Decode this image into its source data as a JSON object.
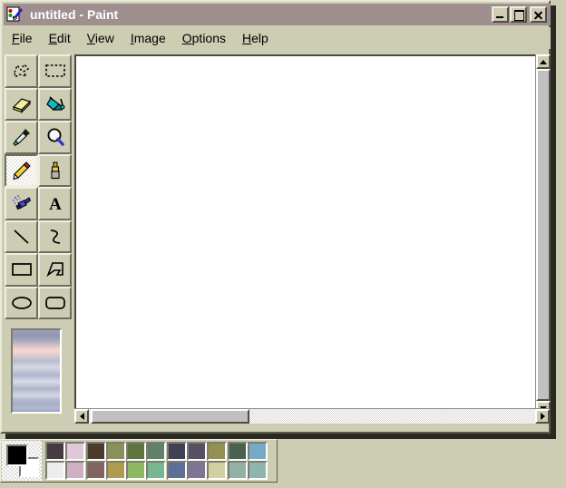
{
  "window": {
    "title": "untitled - Paint",
    "icon": "paint-app-icon",
    "buttons": {
      "minimize": "_",
      "maximize": "□",
      "close": "✕"
    }
  },
  "menubar": {
    "items": [
      {
        "label": "File",
        "accel": "F"
      },
      {
        "label": "Edit",
        "accel": "E"
      },
      {
        "label": "View",
        "accel": "V"
      },
      {
        "label": "Image",
        "accel": "I"
      },
      {
        "label": "Options",
        "accel": "O"
      },
      {
        "label": "Help",
        "accel": "H"
      }
    ]
  },
  "toolbox": {
    "selected": "pencil",
    "tools": [
      {
        "id": "free-form-select",
        "label": "Free-Form Select"
      },
      {
        "id": "rectangle-select",
        "label": "Select"
      },
      {
        "id": "eraser",
        "label": "Eraser/Color Eraser"
      },
      {
        "id": "fill",
        "label": "Fill With Color"
      },
      {
        "id": "color-picker",
        "label": "Pick Color"
      },
      {
        "id": "magnifier",
        "label": "Magnifier"
      },
      {
        "id": "pencil",
        "label": "Pencil"
      },
      {
        "id": "brush",
        "label": "Brush"
      },
      {
        "id": "airbrush",
        "label": "Airbrush"
      },
      {
        "id": "text",
        "label": "Text"
      },
      {
        "id": "line",
        "label": "Line"
      },
      {
        "id": "curve",
        "label": "Curve"
      },
      {
        "id": "rectangle",
        "label": "Rectangle"
      },
      {
        "id": "polygon",
        "label": "Polygon"
      },
      {
        "id": "ellipse",
        "label": "Ellipse"
      },
      {
        "id": "rounded-rectangle",
        "label": "Rounded Rectangle"
      }
    ]
  },
  "tool_options": {
    "preview_label": "tool-options-preview"
  },
  "canvas": {
    "background": "#ffffff"
  },
  "scrollbars": {
    "vertical": {
      "up": "▲",
      "down": "▼"
    },
    "horizontal": {
      "left": "◀",
      "right": "▶"
    }
  },
  "palette": {
    "foreground": "#000000",
    "background": "#ffffff",
    "row1": [
      "#463b41",
      "#e0c8da",
      "#4c3b2c",
      "#8b8f5a",
      "#5e753f",
      "#5d8169",
      "#3f4257",
      "#574f63",
      "#94904f",
      "#4a6050",
      "#76aac4"
    ],
    "row2": [
      "#ececec",
      "#cfafc4",
      "#81645f",
      "#b09a4f",
      "#8cba60",
      "#76b690",
      "#5d6f96",
      "#7d7593",
      "#d2cfa3",
      "#91b2a4",
      "#8fb6ae"
    ]
  }
}
